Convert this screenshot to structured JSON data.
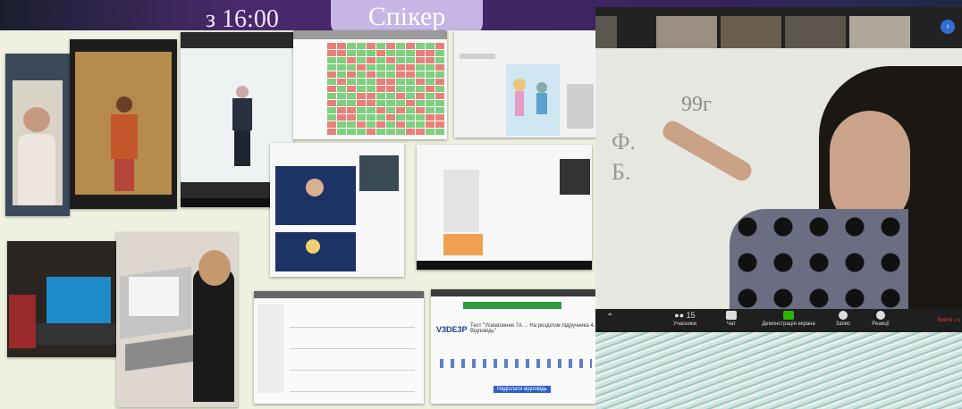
{
  "banner": {
    "time": "з 16:00",
    "speaker": "Спікер"
  },
  "board": {
    "text_top": "99г",
    "text_left1": "Ф.",
    "text_left2": "Б."
  },
  "zoom_toolbar": {
    "participants_count": "15",
    "items": [
      "Учасники",
      "Чат",
      "Демонстрація екрана",
      "Запис",
      "Реакції"
    ],
    "leave": "Вийти з к"
  },
  "form_panel": {
    "code": "V3DE3P",
    "title": "Тест \"Усновлення 7А ... На розділом підручника 4. Відповідь\"",
    "button": "Надіслати відповідь"
  },
  "colors": {
    "grid_green": "#7fcf7f",
    "grid_red": "#e8807a",
    "grid_header": "#9a9a9a",
    "toolbar_share": "#2db300",
    "leave_red": "#e33333"
  },
  "icons": [
    "participants-icon",
    "chat-icon",
    "share-screen-icon",
    "record-icon",
    "reactions-icon",
    "close-circle-icon"
  ]
}
